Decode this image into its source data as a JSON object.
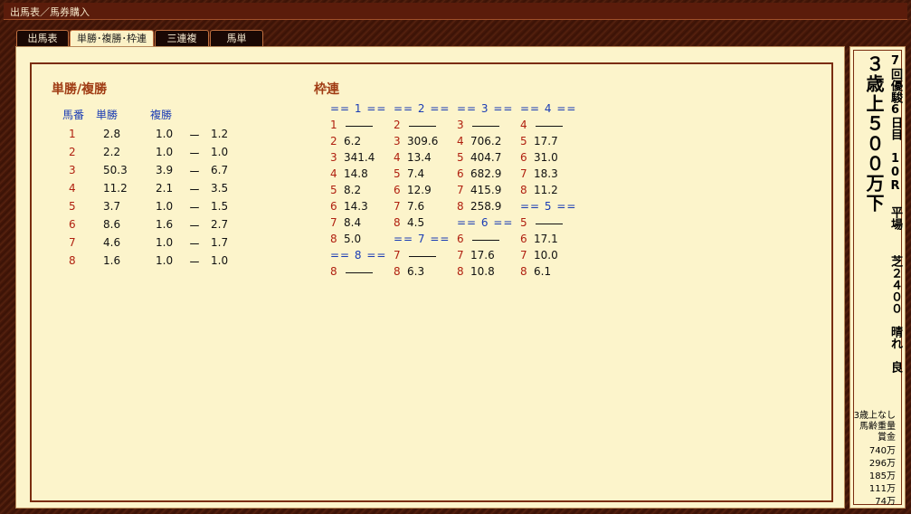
{
  "window": {
    "title": "出馬表／馬券購入"
  },
  "tabs": [
    {
      "label": "出馬表"
    },
    {
      "label": "単勝･複勝･枠連"
    },
    {
      "label": "三連複"
    },
    {
      "label": "馬単"
    }
  ],
  "win_place": {
    "title": "単勝/複勝",
    "headers": {
      "horse_no": "馬番",
      "win": "単勝",
      "place": "複勝"
    },
    "rows": [
      {
        "no": "1",
        "win": "2.8",
        "place_min": "1.0",
        "dash": "ー",
        "place_max": "1.2"
      },
      {
        "no": "2",
        "win": "2.2",
        "place_min": "1.0",
        "dash": "ー",
        "place_max": "1.0"
      },
      {
        "no": "3",
        "win": "50.3",
        "place_min": "3.9",
        "dash": "ー",
        "place_max": "6.7"
      },
      {
        "no": "4",
        "win": "11.2",
        "place_min": "2.1",
        "dash": "ー",
        "place_max": "3.5"
      },
      {
        "no": "5",
        "win": "3.7",
        "place_min": "1.0",
        "dash": "ー",
        "place_max": "1.5"
      },
      {
        "no": "6",
        "win": "8.6",
        "place_min": "1.6",
        "dash": "ー",
        "place_max": "2.7"
      },
      {
        "no": "7",
        "win": "4.6",
        "place_min": "1.0",
        "dash": "ー",
        "place_max": "1.7"
      },
      {
        "no": "8",
        "win": "1.6",
        "place_min": "1.0",
        "dash": "ー",
        "place_max": "1.0"
      }
    ]
  },
  "bracket": {
    "title": "枠連",
    "groups": [
      {
        "header": "== 1 ==",
        "rows": [
          {
            "n": "1",
            "v": ""
          },
          {
            "n": "2",
            "v": "6.2"
          },
          {
            "n": "3",
            "v": "341.4"
          },
          {
            "n": "4",
            "v": "14.8"
          },
          {
            "n": "5",
            "v": "8.2"
          },
          {
            "n": "6",
            "v": "14.3"
          },
          {
            "n": "7",
            "v": "8.4"
          },
          {
            "n": "8",
            "v": "5.0"
          }
        ]
      },
      {
        "header": "== 2 ==",
        "rows": [
          {
            "n": "2",
            "v": ""
          },
          {
            "n": "3",
            "v": "309.6"
          },
          {
            "n": "4",
            "v": "13.4"
          },
          {
            "n": "5",
            "v": "7.4"
          },
          {
            "n": "6",
            "v": "12.9"
          },
          {
            "n": "7",
            "v": "7.6"
          },
          {
            "n": "8",
            "v": "4.5"
          }
        ]
      },
      {
        "header": "== 3 ==",
        "rows": [
          {
            "n": "3",
            "v": ""
          },
          {
            "n": "4",
            "v": "706.2"
          },
          {
            "n": "5",
            "v": "404.7"
          },
          {
            "n": "6",
            "v": "682.9"
          },
          {
            "n": "7",
            "v": "415.9"
          },
          {
            "n": "8",
            "v": "258.9"
          }
        ]
      },
      {
        "header": "== 4 ==",
        "rows": [
          {
            "n": "4",
            "v": ""
          },
          {
            "n": "5",
            "v": "17.7"
          },
          {
            "n": "6",
            "v": "31.0"
          },
          {
            "n": "7",
            "v": "18.3"
          },
          {
            "n": "8",
            "v": "11.2"
          }
        ]
      },
      {
        "header": "== 5 ==",
        "rows": [
          {
            "n": "5",
            "v": ""
          },
          {
            "n": "6",
            "v": "17.1"
          },
          {
            "n": "7",
            "v": "10.0"
          },
          {
            "n": "8",
            "v": "6.1"
          }
        ]
      },
      {
        "header": "== 6 ==",
        "rows": [
          {
            "n": "6",
            "v": ""
          },
          {
            "n": "7",
            "v": "17.6"
          },
          {
            "n": "8",
            "v": "10.8"
          }
        ]
      },
      {
        "header": "== 7 ==",
        "rows": [
          {
            "n": "7",
            "v": ""
          },
          {
            "n": "8",
            "v": "6.3"
          }
        ]
      },
      {
        "header": "== 8 ==",
        "rows": [
          {
            "n": "8",
            "v": ""
          }
        ]
      }
    ]
  },
  "race": {
    "name": "３歳上５００万下",
    "meeting": "7回優駿6日目　10R 平場",
    "course": "芝２４００　晴れ　良",
    "conditions_line1": "3歳上なし",
    "conditions_line2": "馬齢重量",
    "prize_label": "賞金",
    "prizes": [
      "740万",
      "296万",
      "185万",
      "111万",
      "74万"
    ]
  }
}
